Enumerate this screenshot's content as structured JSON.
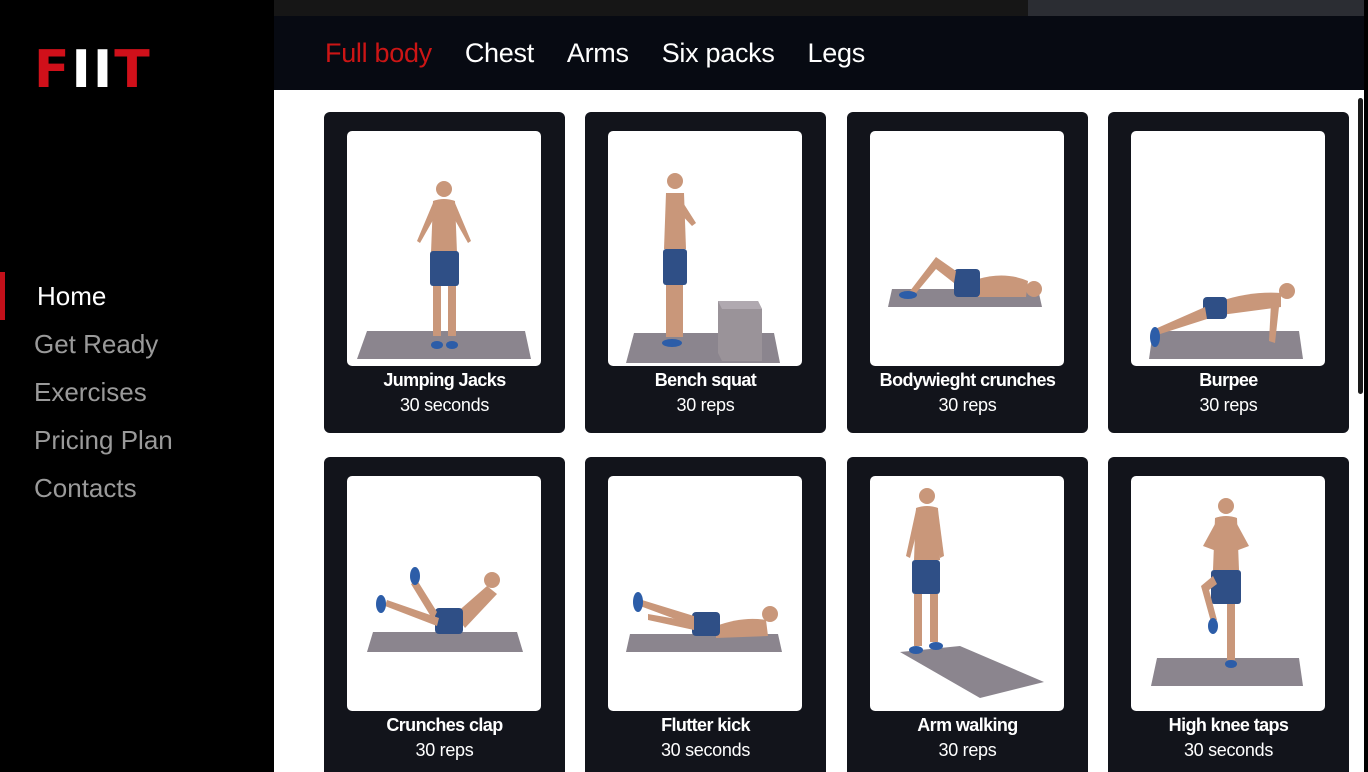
{
  "brand": {
    "logo_f": "F",
    "logo_ii": "II",
    "logo_t": "T",
    "accent_color": "#d0101a"
  },
  "sidebar": {
    "items": [
      {
        "label": "Home",
        "active": true
      },
      {
        "label": "Get Ready",
        "active": false
      },
      {
        "label": "Exercises",
        "active": false
      },
      {
        "label": "Pricing Plan",
        "active": false
      },
      {
        "label": "Contacts",
        "active": false
      }
    ]
  },
  "tabs": [
    {
      "label": "Full body",
      "active": true
    },
    {
      "label": "Chest",
      "active": false
    },
    {
      "label": "Arms",
      "active": false
    },
    {
      "label": "Six packs",
      "active": false
    },
    {
      "label": "Legs",
      "active": false
    }
  ],
  "exercises": [
    {
      "name": "Jumping Jacks",
      "detail": "30 seconds",
      "pose": "standing-front"
    },
    {
      "name": "Bench squat",
      "detail": "30 reps",
      "pose": "bench-squat"
    },
    {
      "name": "Bodywieght crunches",
      "detail": "30 reps",
      "pose": "lying-crunch"
    },
    {
      "name": "Burpee",
      "detail": "30 reps",
      "pose": "plank"
    },
    {
      "name": "Crunches clap",
      "detail": "30 reps",
      "pose": "v-crunch"
    },
    {
      "name": "Flutter kick",
      "detail": "30 seconds",
      "pose": "flutter"
    },
    {
      "name": "Arm walking",
      "detail": "30 reps",
      "pose": "standing-angled"
    },
    {
      "name": "High knee taps",
      "detail": "30 seconds",
      "pose": "high-knee"
    }
  ]
}
